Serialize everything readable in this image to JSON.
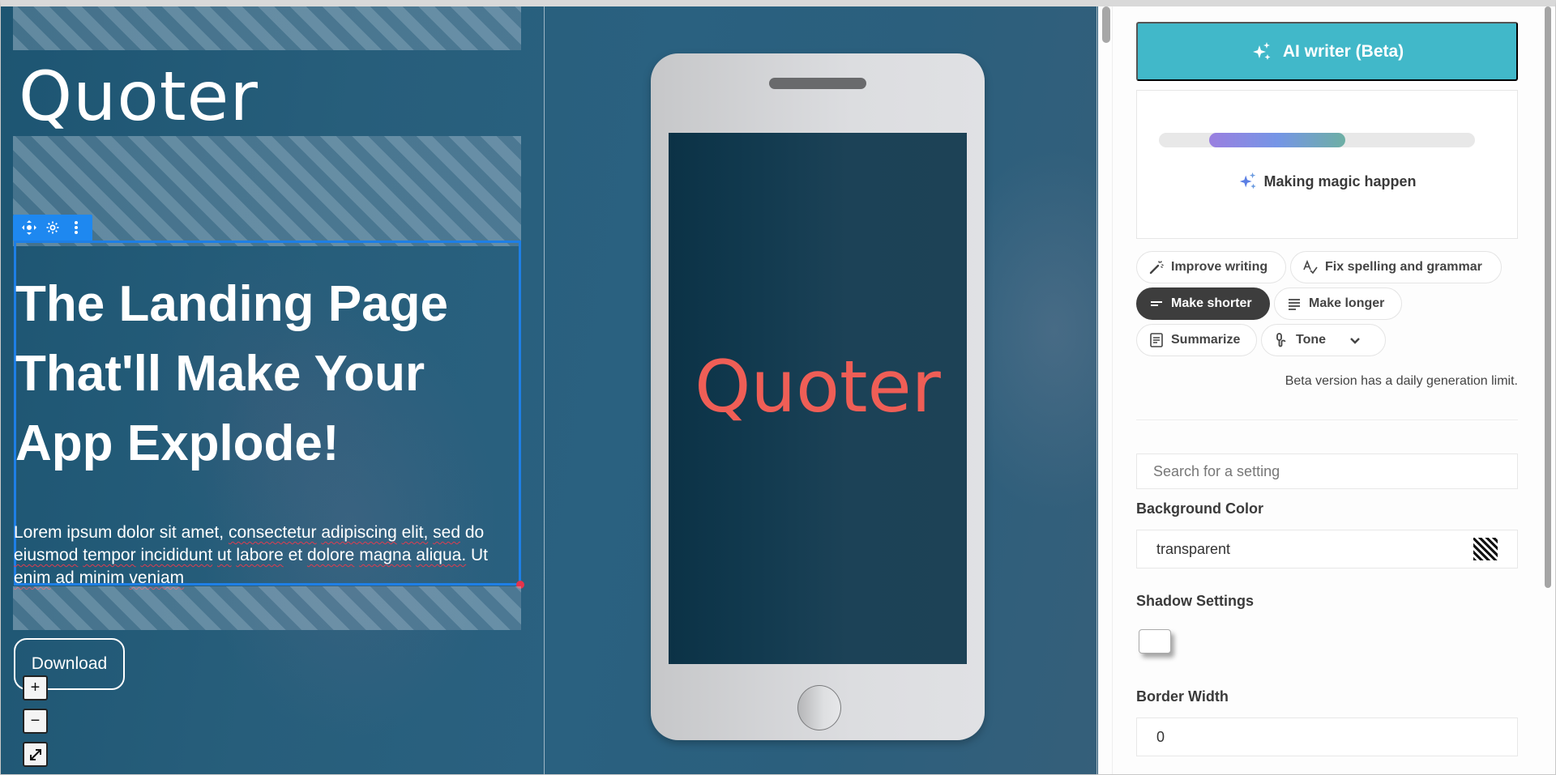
{
  "canvas": {
    "logo_text": "Quoter",
    "block_toolbar": {
      "move_icon": "move-icon",
      "settings_icon": "gear-icon",
      "more_icon": "more-vertical-icon"
    },
    "headline": "The Landing Page That'll Make Your App Explode!",
    "body_words": [
      "Lorem ipsum dolor sit amet,",
      "consectetur",
      "adipiscing",
      "elit,",
      "sed",
      "do",
      "eiusmod",
      "tempor",
      "incididunt",
      "ut",
      "labore",
      "et",
      "dolore",
      "magna",
      "aliqua.",
      "Ut",
      "enim",
      "ad minim",
      "veniam"
    ],
    "download_label": "Download",
    "zoom_controls": {
      "zoom_in": "+",
      "zoom_out": "−",
      "fullscreen": "⤢"
    },
    "phone_logo": "Quoter"
  },
  "panel": {
    "ai_writer_label": "AI writer (Beta)",
    "progress": {
      "fill_start": 0.16,
      "fill_end": 0.59
    },
    "magic_text": "Making magic happen",
    "chips": [
      {
        "label": "Improve writing",
        "icon": "magic-wand-icon",
        "active": false
      },
      {
        "label": "Fix spelling and grammar",
        "icon": "spell-check-icon",
        "active": false
      },
      {
        "label": "Make shorter",
        "icon": "short-lines-icon",
        "active": true
      },
      {
        "label": "Make longer",
        "icon": "long-lines-icon",
        "active": false
      },
      {
        "label": "Summarize",
        "icon": "document-icon",
        "active": false
      },
      {
        "label": "Tone",
        "icon": "microphone-icon",
        "active": false
      }
    ],
    "beta_note": "Beta version has a daily generation limit.",
    "search_placeholder": "Search for a setting",
    "background_color_label": "Background Color",
    "background_color_value": "transparent",
    "shadow_settings_label": "Shadow Settings",
    "border_width_label": "Border Width",
    "border_width_value": "0"
  },
  "colors": {
    "accent": "#41b8c9",
    "selection": "#1e7fe6",
    "phone_logo": "#ef5e56",
    "active_chip": "#3d3d3d"
  }
}
